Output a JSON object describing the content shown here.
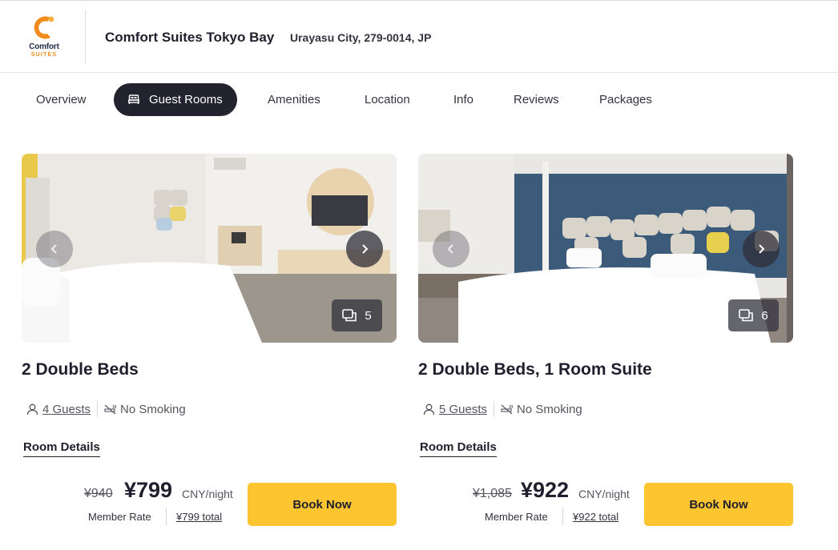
{
  "brand": {
    "logo_word": "Comfort",
    "logo_sub": "SUITES",
    "accent_color": "#f08a1c"
  },
  "hotel": {
    "name": "Comfort Suites Tokyo Bay",
    "address": "Urayasu City, 279-0014, JP"
  },
  "tabs": [
    {
      "label": "Overview",
      "active": false
    },
    {
      "label": "Guest Rooms",
      "active": true,
      "icon": "bed-icon"
    },
    {
      "label": "Amenities",
      "active": false
    },
    {
      "label": "Location",
      "active": false
    },
    {
      "label": "Info",
      "active": false
    },
    {
      "label": "Reviews",
      "active": false
    },
    {
      "label": "Packages",
      "active": false
    }
  ],
  "rooms": [
    {
      "title": "2 Double Beds",
      "photo_count": "5",
      "guests": "4 Guests",
      "smoking": "No Smoking",
      "details_label": "Room Details",
      "old_price": "¥940",
      "price": "¥799",
      "unit": "CNY/night",
      "member_rate": "Member Rate",
      "total": "¥799 total",
      "book_label": "Book Now"
    },
    {
      "title": "2 Double Beds, 1 Room Suite",
      "photo_count": "6",
      "guests": "5 Guests",
      "smoking": "No Smoking",
      "details_label": "Room Details",
      "old_price": "¥1,085",
      "price": "¥922",
      "unit": "CNY/night",
      "member_rate": "Member Rate",
      "total": "¥922 total",
      "book_label": "Book Now"
    }
  ],
  "colors": {
    "active_tab": "#23232f",
    "book_button": "#fdc52f"
  }
}
